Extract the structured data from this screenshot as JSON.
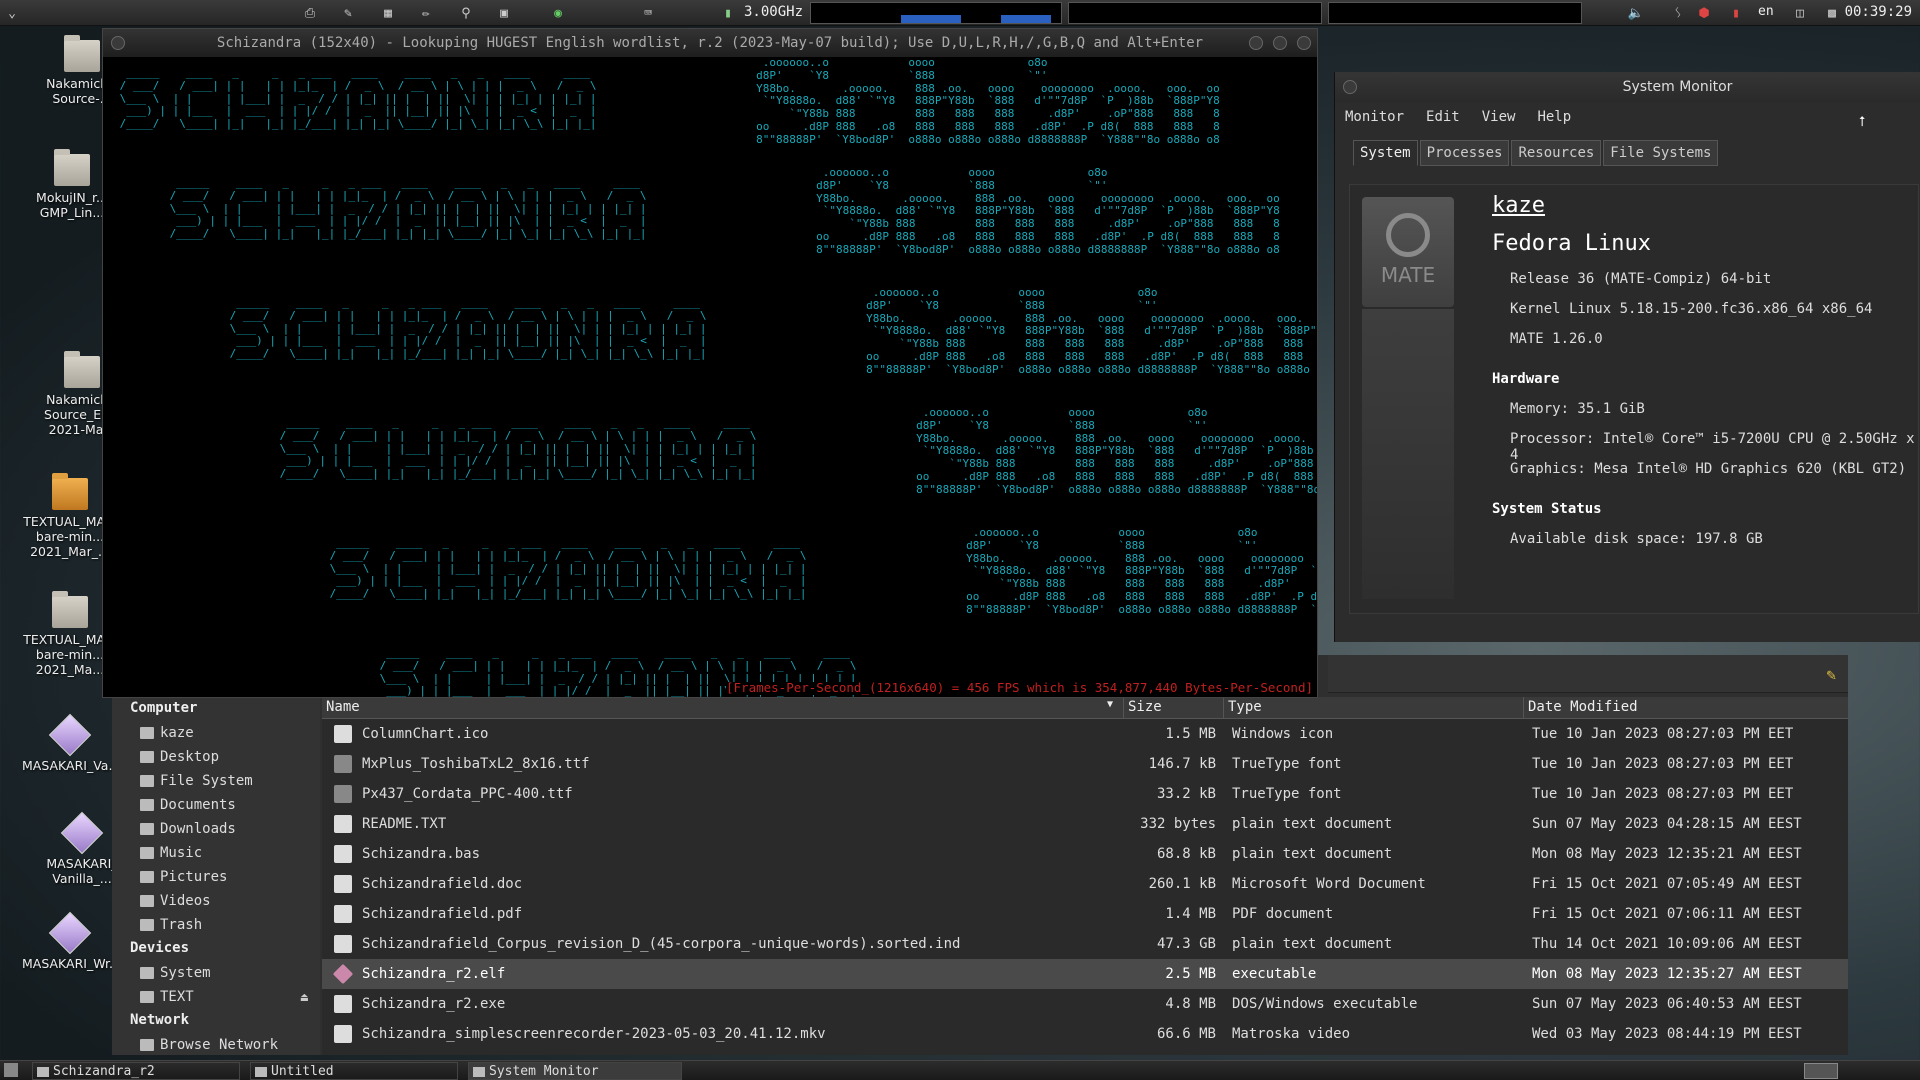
{
  "top_panel": {
    "cpu_freq": "3.00GHz",
    "lang": "en",
    "clock": "00:39:29"
  },
  "desktop_icons": [
    {
      "label": "Nakamichi_ Source-..."
    },
    {
      "label": "MokujIN_r... GMP_Lin..."
    },
    {
      "label": "Nakamichi_ Source_EL... 2021-Ma..."
    },
    {
      "label": "TEXTUAL_MA... bare-min... 2021_Mar_..."
    },
    {
      "label": "TEXTUAL_MA... bare-min... 2021_Ma..."
    },
    {
      "label": "MASAKARI_Va..."
    },
    {
      "label": "MASAKARI_ Vanilla_..."
    },
    {
      "label": "MASAKARI_Wr..."
    }
  ],
  "terminal": {
    "title": "Schizandra (152x40) - Lookuping HUGEST English wordlist, r.2 (2023-May-07 build); Use D,U,L,R,H,/,G,B,Q and Alt+Enter",
    "fps_line": "[Frames-Per-Second_(1216x640) = 456 FPS which is 354,877,440 Bytes-Per-Second]",
    "banner_a": "  _____    ____   _     _   _ ___   ____    ____   _   _   ____     ____  \n / ___/   / ___| | |   | | |_|_  | /  _ \\  / __ \\ | \\ | | |  _ \\   /  _ \\ \n \\___ \\  | |     | |___| |  _  / / | |_| || |  | ||  \\| | | |_| | | |_| |\n  ___) | | |___  |  ___  | | |/ /  |  _  || |__| || |\\  | |  _ <  |  _  |\n /____/   \\____| |_|   |_| |_/___| |_| |_| \\____/ |_| \\_| |_| \\_\\ |_| |_|",
    "banner_b": "      .oooooo..o            oooo              o8o\n     d8P'    `Y8            `888              `\"'\n     Y88bo.       .ooooo.    888 .oo.   oooo    oooooooo  .oooo.   ooo.  oo\n      `\"Y8888o.  d88' `\"Y8   888P\"Y88b  `888   d'\"\"7d8P  `P  )88b  `888P\"Y8\n          `\"Y88b 888         888   888   888     .d8P'    .oP\"888   888   8\n     oo     .d8P 888   .o8   888   888   888   .d8P'  .P d8(  888   888   8\n     8\"\"88888P'  `Y8bod8P'  o888o o888o o888o d8888888P  `Y888\"\"8o o888o o8"
  },
  "system_monitor": {
    "title": "System Monitor",
    "menu": [
      "Monitor",
      "Edit",
      "View",
      "Help"
    ],
    "tabs": [
      "System",
      "Processes",
      "Resources",
      "File Systems"
    ],
    "logo_text": "MATE",
    "hostname": "kaze",
    "os": "Fedora Linux",
    "release": "Release 36 (MATE-Compiz) 64-bit",
    "kernel": "Kernel Linux 5.18.15-200.fc36.x86_64 x86_64",
    "mate": "MATE 1.26.0",
    "hardware_heading": "Hardware",
    "memory": "Memory:    35.1 GiB",
    "processor": "Processor: Intel® Core™ i5-7200U CPU @ 2.50GHz x 4",
    "graphics": "Graphics:  Mesa Intel® HD Graphics 620 (KBL GT2)",
    "status_heading": "System Status",
    "disk": "Available disk space:  197.8 GB"
  },
  "file_manager": {
    "sidebar": {
      "computer_heading": "Computer",
      "computer_items": [
        "kaze",
        "Desktop",
        "File System",
        "Documents",
        "Downloads",
        "Music",
        "Pictures",
        "Videos",
        "Trash"
      ],
      "devices_heading": "Devices",
      "device_items": [
        "System",
        "TEXT"
      ],
      "network_heading": "Network",
      "network_items": [
        "Browse Network"
      ]
    },
    "columns": [
      "Name",
      "Size",
      "Type",
      "Date Modified"
    ],
    "rows": [
      {
        "name": "ColumnChart.ico",
        "size": "1.5 MB",
        "type": "Windows icon",
        "date": "Tue 10 Jan 2023 08:27:03 PM EET"
      },
      {
        "name": "MxPlus_ToshibaTxL2_8x16.ttf",
        "size": "146.7 kB",
        "type": "TrueType font",
        "date": "Tue 10 Jan 2023 08:27:03 PM EET"
      },
      {
        "name": "Px437_Cordata_PPC-400.ttf",
        "size": "33.2 kB",
        "type": "TrueType font",
        "date": "Tue 10 Jan 2023 08:27:03 PM EET"
      },
      {
        "name": "README.TXT",
        "size": "332 bytes",
        "type": "plain text document",
        "date": "Sun 07 May 2023 04:28:15 AM EEST"
      },
      {
        "name": "Schizandra.bas",
        "size": "68.8 kB",
        "type": "plain text document",
        "date": "Mon 08 May 2023 12:35:21 AM EEST"
      },
      {
        "name": "Schizandrafield.doc",
        "size": "260.1 kB",
        "type": "Microsoft Word Document",
        "date": "Fri 15 Oct 2021 07:05:49 AM EEST"
      },
      {
        "name": "Schizandrafield.pdf",
        "size": "1.4 MB",
        "type": "PDF document",
        "date": "Fri 15 Oct 2021 07:06:11 AM EEST"
      },
      {
        "name": "Schizandrafield_Corpus_revision_D_(45-corpora_-unique-words).sorted.ind",
        "size": "47.3 GB",
        "type": "plain text document",
        "date": "Thu 14 Oct 2021 10:09:06 AM EEST"
      },
      {
        "name": "Schizandra_r2.elf",
        "size": "2.5 MB",
        "type": "executable",
        "date": "Mon 08 May 2023 12:35:27 AM EEST"
      },
      {
        "name": "Schizandra_r2.exe",
        "size": "4.8 MB",
        "type": "DOS/Windows executable",
        "date": "Sun 07 May 2023 06:40:53 AM EEST"
      },
      {
        "name": "Schizandra_simplescreenrecorder-2023-05-03_20.41.12.mkv",
        "size": "66.6 MB",
        "type": "Matroska video",
        "date": "Wed 03 May 2023 08:44:19 PM EEST"
      }
    ]
  },
  "taskbar": {
    "tasks": [
      "Schizandra_r2",
      "Untitled",
      "System Monitor"
    ]
  }
}
